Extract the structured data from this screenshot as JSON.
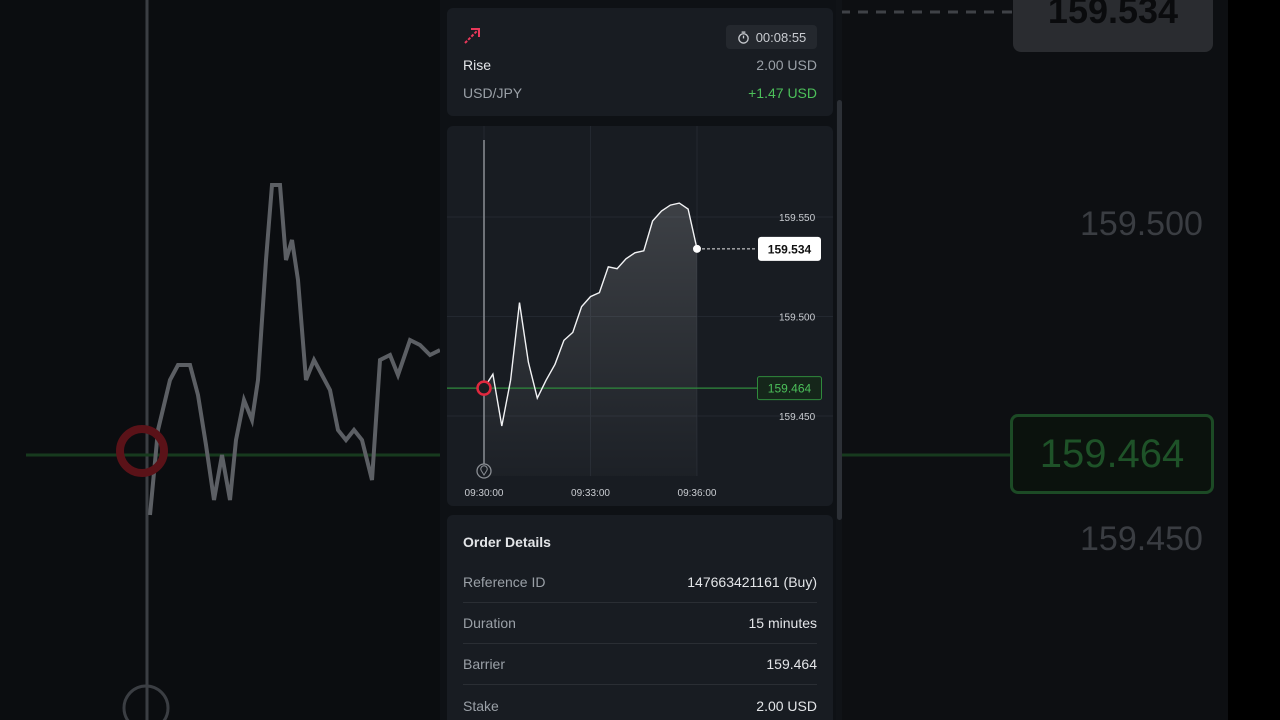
{
  "contract": {
    "direction_icon": "arrow-up-right-icon",
    "timer_icon": "stopwatch-icon",
    "timer": "00:08:55",
    "type": "Rise",
    "stake": "2.00 USD",
    "symbol": "USD/JPY",
    "profit": "+1.47 USD",
    "profit_color": "#4cbf5a",
    "direction_color": "#e8385a"
  },
  "chart_data": {
    "type": "line",
    "x_ticks": [
      "09:30:00",
      "09:33:00",
      "09:36:00"
    ],
    "y_ticks": [
      "159.550",
      "159.500",
      "159.450"
    ],
    "current_price": "159.534",
    "barrier": "159.464",
    "entry_marker": "location-pin-icon",
    "series": [
      {
        "x": [
          "09:30:00",
          "09:30:15",
          "09:30:30",
          "09:30:45",
          "09:31:00",
          "09:31:15",
          "09:31:30",
          "09:31:45",
          "09:32:00",
          "09:32:15",
          "09:32:30",
          "09:32:45",
          "09:33:00",
          "09:33:15",
          "09:33:30",
          "09:33:45",
          "09:34:00",
          "09:34:15",
          "09:34:30",
          "09:34:45",
          "09:35:00",
          "09:35:15",
          "09:35:30",
          "09:35:45",
          "09:36:00"
        ],
        "values": [
          159.464,
          159.471,
          159.445,
          159.468,
          159.507,
          159.477,
          159.459,
          159.468,
          159.476,
          159.488,
          159.492,
          159.505,
          159.51,
          159.512,
          159.525,
          159.524,
          159.529,
          159.532,
          159.533,
          159.548,
          159.553,
          159.556,
          159.557,
          159.554,
          159.534
        ]
      }
    ]
  },
  "order_details": {
    "title": "Order Details",
    "rows": [
      {
        "label": "Reference ID",
        "value": "147663421161 (Buy)"
      },
      {
        "label": "Duration",
        "value": "15 minutes"
      },
      {
        "label": "Barrier",
        "value": "159.464"
      },
      {
        "label": "Stake",
        "value": "2.00 USD"
      }
    ]
  },
  "background": {
    "price_top": "159.534",
    "price_upper": "159.500",
    "price_barrier": "159.464",
    "price_lower": "159.450"
  }
}
